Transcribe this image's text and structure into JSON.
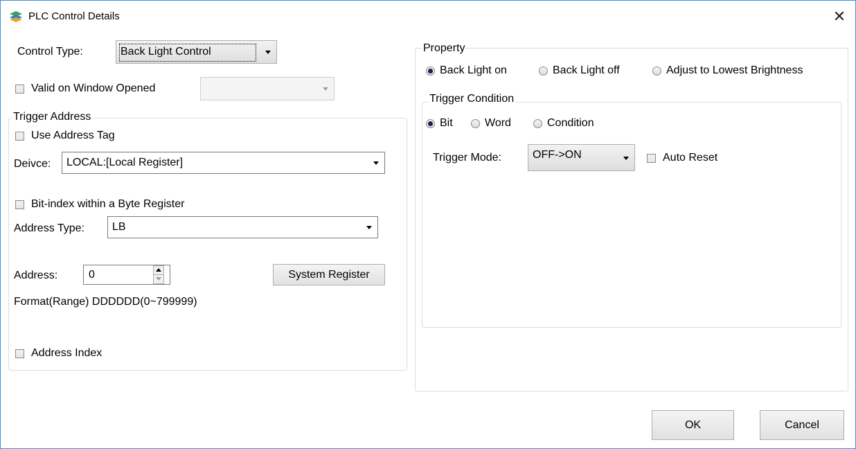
{
  "window": {
    "title": "PLC Control Details",
    "close_glyph": "✕"
  },
  "control_type": {
    "label": "Control Type:",
    "value": "Back Light Control"
  },
  "valid_on_window_opened": {
    "label": "Valid on Window Opened",
    "checked": false,
    "value": ""
  },
  "trigger_address": {
    "title": "Trigger Address",
    "use_address_tag": {
      "label": "Use Address Tag",
      "checked": false
    },
    "device": {
      "label": "Deivce:",
      "value": "LOCAL:[Local Register]"
    },
    "bit_index": {
      "label": "Bit-index within a Byte Register",
      "checked": false
    },
    "address_type": {
      "label": "Address Type:",
      "value": "LB"
    },
    "address": {
      "label": "Address:",
      "value": "0"
    },
    "system_register_button": "System Register",
    "format_range": "Format(Range)  DDDDDD(0~799999)",
    "address_index": {
      "label": "Address Index",
      "checked": false
    }
  },
  "property": {
    "title": "Property",
    "options": [
      {
        "label": "Back Light on",
        "selected": true
      },
      {
        "label": "Back Light off",
        "selected": false
      },
      {
        "label": "Adjust to Lowest Brightness",
        "selected": false
      }
    ],
    "trigger_condition": {
      "title": "Trigger Condition",
      "options": [
        {
          "label": "Bit",
          "selected": true
        },
        {
          "label": "Word",
          "selected": false
        },
        {
          "label": "Condition",
          "selected": false
        }
      ],
      "trigger_mode": {
        "label": "Trigger Mode:",
        "value": "OFF->ON"
      },
      "auto_reset": {
        "label": "Auto Reset",
        "checked": false
      }
    }
  },
  "buttons": {
    "ok": "OK",
    "cancel": "Cancel"
  },
  "icons": {
    "app": "plc-app-icon",
    "close": "close-icon",
    "dropdown": "chevron-down-icon"
  }
}
